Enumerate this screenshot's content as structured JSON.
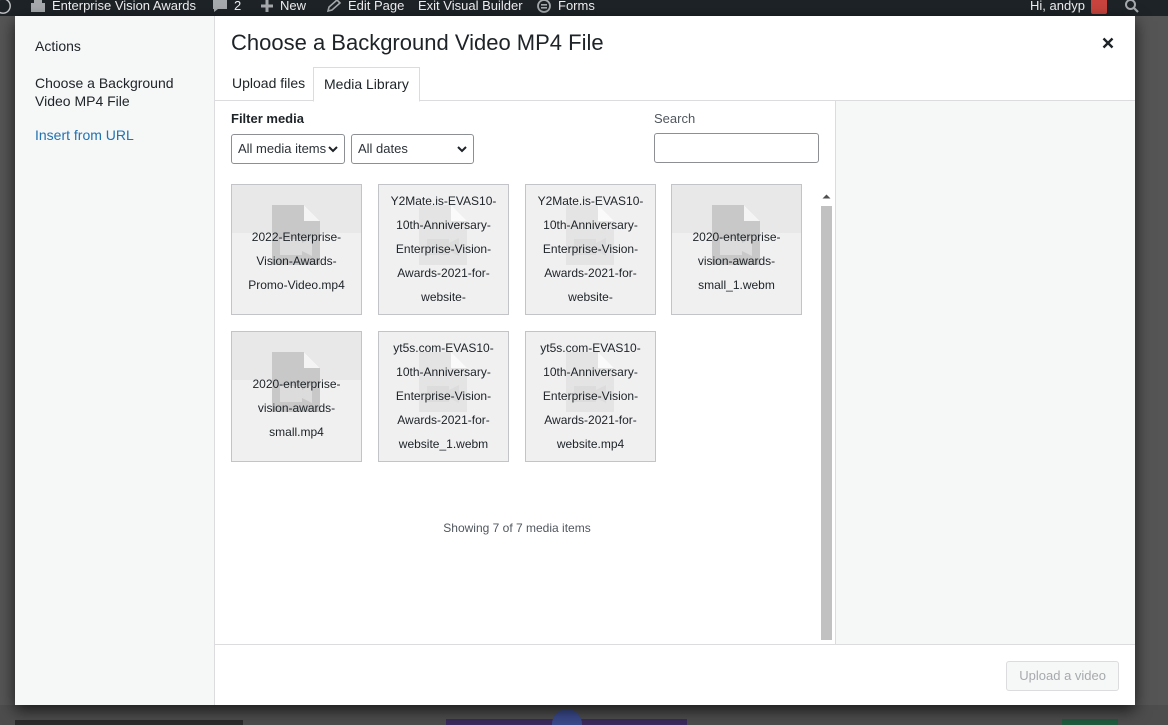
{
  "admin_bar": {
    "site_name": "Enterprise Vision Awards",
    "comments_count": "2",
    "new_label": "New",
    "edit_page_label": "Edit Page",
    "exit_builder_label": "Exit Visual Builder",
    "forms_label": "Forms",
    "greeting": "Hi, andyp"
  },
  "modal": {
    "menu": {
      "heading": "Actions",
      "active_item": "Choose a Background Video MP4 File",
      "link_item": "Insert from URL"
    },
    "title": "Choose a Background Video MP4 File",
    "tabs": [
      "Upload files",
      "Media Library"
    ],
    "active_tab": "Media Library",
    "filter": {
      "label": "Filter media",
      "type_selected": "All media items",
      "date_selected": "All dates"
    },
    "search": {
      "label": "Search",
      "value": ""
    },
    "attachments": [
      {
        "name": "2022-Enterprise-Vision-Awards-Promo-Video.mp4",
        "lines": [
          "2022-Enterprise-",
          "Vision-Awards-",
          "Promo-Video.mp4"
        ]
      },
      {
        "name": "Y2Mate.is-EVAS10-10th-Anniversary-Enterprise-Vision-Awards-2021-for-website-",
        "lines": [
          "Y2Mate.is-EVAS10-",
          "10th-Anniversary-",
          "Enterprise-Vision-",
          "Awards-2021-for-",
          "website-"
        ]
      },
      {
        "name": "Y2Mate.is-EVAS10-10th-Anniversary-Enterprise-Vision-Awards-2021-for-website-",
        "lines": [
          "Y2Mate.is-EVAS10-",
          "10th-Anniversary-",
          "Enterprise-Vision-",
          "Awards-2021-for-",
          "website-"
        ]
      },
      {
        "name": "2020-enterprise-vision-awards-small_1.webm",
        "lines": [
          "2020-enterprise-",
          "vision-awards-",
          "small_1.webm"
        ]
      },
      {
        "name": "2020-enterprise-vision-awards-small.mp4",
        "lines": [
          "2020-enterprise-",
          "vision-awards-",
          "small.mp4"
        ]
      },
      {
        "name": "yt5s.com-EVAS10-10th-Anniversary-Enterprise-Vision-Awards-2021-for-website_1.webm",
        "lines": [
          "yt5s.com-EVAS10-",
          "10th-Anniversary-",
          "Enterprise-Vision-",
          "Awards-2021-for-",
          "website_1.webm"
        ]
      },
      {
        "name": "yt5s.com-EVAS10-10th-Anniversary-Enterprise-Vision-Awards-2021-for-website.mp4",
        "lines": [
          "yt5s.com-EVAS10-",
          "10th-Anniversary-",
          "Enterprise-Vision-",
          "Awards-2021-for-",
          "website.mp4"
        ]
      }
    ],
    "count_text": "Showing 7 of 7 media items",
    "upload_button": "Upload a video"
  },
  "icons": {
    "wp_logo": "wordpress-logo-icon",
    "site": "home-icon",
    "comments": "speech-bubble-icon",
    "new": "plus-icon",
    "edit": "pencil-icon",
    "forms": "forms-icon",
    "search": "search-icon",
    "close": "close-icon",
    "file": "video-file-icon"
  },
  "colors": {
    "admin_bar": "#1d2327",
    "link": "#2271b1",
    "disabled_text": "#a7aaad"
  }
}
